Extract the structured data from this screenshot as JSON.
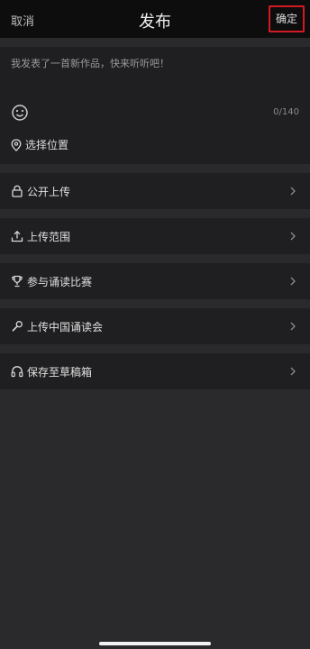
{
  "header": {
    "cancel_label": "取消",
    "title": "发布",
    "confirm_label": "确定"
  },
  "compose": {
    "text": "我发表了一首新作品，快来听听吧！",
    "char_count": "0/140",
    "location_label": "选择位置"
  },
  "settings": {
    "items": [
      {
        "label": "公开上传",
        "icon": "lock-icon"
      },
      {
        "label": "上传范围",
        "icon": "upload-icon"
      },
      {
        "label": "参与诵读比赛",
        "icon": "trophy-icon"
      },
      {
        "label": "上传中国诵读会",
        "icon": "microphone-icon"
      },
      {
        "label": "保存至草稿箱",
        "icon": "headphones-icon"
      }
    ]
  },
  "colors": {
    "highlight_border": "#d11a24",
    "background": "#1f1f21",
    "header_background": "#0d0d0d"
  }
}
